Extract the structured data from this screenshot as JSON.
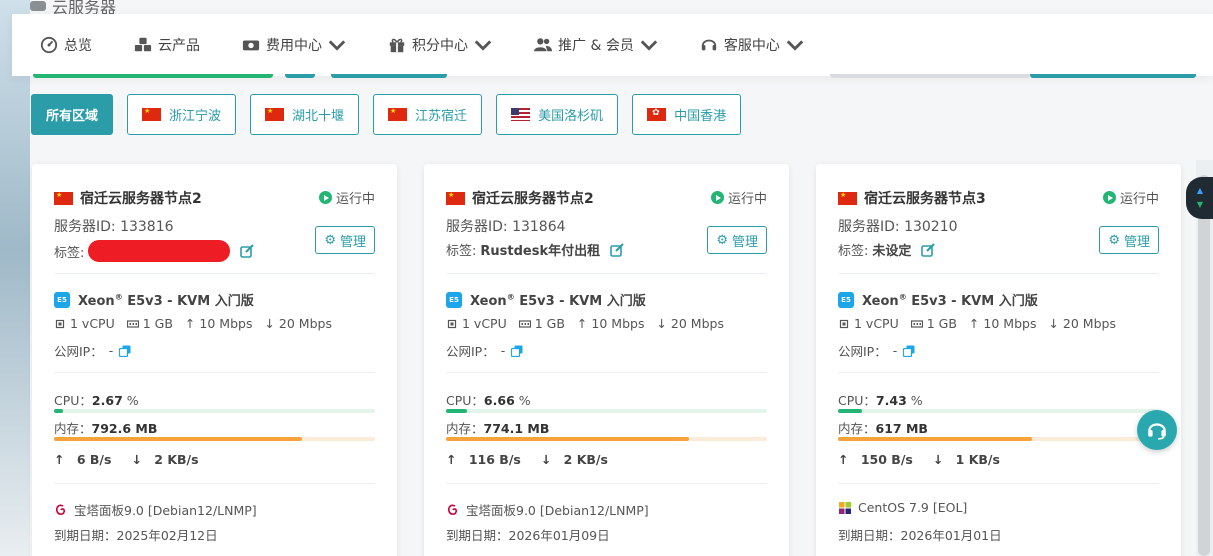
{
  "page": {
    "heading": "云服务器"
  },
  "nav": [
    {
      "label": "总览",
      "icon": "dashboard-icon",
      "dropdown": false
    },
    {
      "label": "云产品",
      "icon": "cubes-icon",
      "dropdown": false
    },
    {
      "label": "费用中心",
      "icon": "money-icon",
      "dropdown": true
    },
    {
      "label": "积分中心",
      "icon": "gift-icon",
      "dropdown": true
    },
    {
      "label": "推广 & 会员",
      "icon": "users-icon",
      "dropdown": true
    },
    {
      "label": "客服中心",
      "icon": "headset-icon",
      "dropdown": true
    }
  ],
  "regions": [
    {
      "label": "所有区域",
      "flag": "",
      "active": true
    },
    {
      "label": "浙江宁波",
      "flag": "cn",
      "active": false
    },
    {
      "label": "湖北十堰",
      "flag": "cn",
      "active": false
    },
    {
      "label": "江苏宿迁",
      "flag": "cn",
      "active": false
    },
    {
      "label": "美国洛杉矶",
      "flag": "us",
      "active": false
    },
    {
      "label": "中国香港",
      "flag": "hk",
      "active": false
    }
  ],
  "labels": {
    "server_id": "服务器ID: ",
    "tag": "标签: ",
    "manage": "管理",
    "public_ip": "公网IP：",
    "cpu": "CPU：",
    "mem": "内存：",
    "expire": "到期日期："
  },
  "servers": [
    {
      "name": "宿迁云服务器节点2",
      "status": "运行中",
      "id": "133816",
      "tag": "",
      "tag_redacted": true,
      "plan": "Xeon",
      "plan_rest": " E5v3 - KVM 入门版",
      "vcpu": "1 vCPU",
      "ram": "1 GB",
      "up_bw": "10 Mbps",
      "down_bw": "20 Mbps",
      "ip": "-",
      "cpu": "2.67",
      "cpu_pct": 2.67,
      "mem": "792.6 MB",
      "mem_pct": 77.4,
      "up": "6 B/s",
      "down": "2 KB/s",
      "os": "宝塔面板9.0 [Debian12/LNMP]",
      "os_icon": "debian-icon",
      "expire": "2025年02月12日"
    },
    {
      "name": "宿迁云服务器节点2",
      "status": "运行中",
      "id": "131864",
      "tag": "Rustdesk年付出租",
      "tag_redacted": false,
      "plan": "Xeon",
      "plan_rest": " E5v3 - KVM 入门版",
      "vcpu": "1 vCPU",
      "ram": "1 GB",
      "up_bw": "10 Mbps",
      "down_bw": "20 Mbps",
      "ip": "-",
      "cpu": "6.66",
      "cpu_pct": 6.66,
      "mem": "774.1 MB",
      "mem_pct": 75.6,
      "up": "116 B/s",
      "down": "2 KB/s",
      "os": "宝塔面板9.0 [Debian12/LNMP]",
      "os_icon": "debian-icon",
      "expire": "2026年01月09日"
    },
    {
      "name": "宿迁云服务器节点3",
      "status": "运行中",
      "id": "130210",
      "tag": "未设定",
      "tag_redacted": false,
      "plan": "Xeon",
      "plan_rest": " E5v3 - KVM 入门版",
      "vcpu": "1 vCPU",
      "ram": "1 GB",
      "up_bw": "10 Mbps",
      "down_bw": "20 Mbps",
      "ip": "-",
      "cpu": "7.43",
      "cpu_pct": 7.43,
      "mem": "617 MB",
      "mem_pct": 60.3,
      "up": "150 B/s",
      "down": "1 KB/s",
      "os": "CentOS 7.9 [EOL]",
      "os_icon": "centos-icon",
      "expire": "2026年01月01日"
    }
  ],
  "colors": {
    "accent": "#2a9da8",
    "running": "#22b573",
    "cpu_bar": "#22b573",
    "mem_bar": "#f7a23b",
    "redaction": "#ee1c25"
  }
}
